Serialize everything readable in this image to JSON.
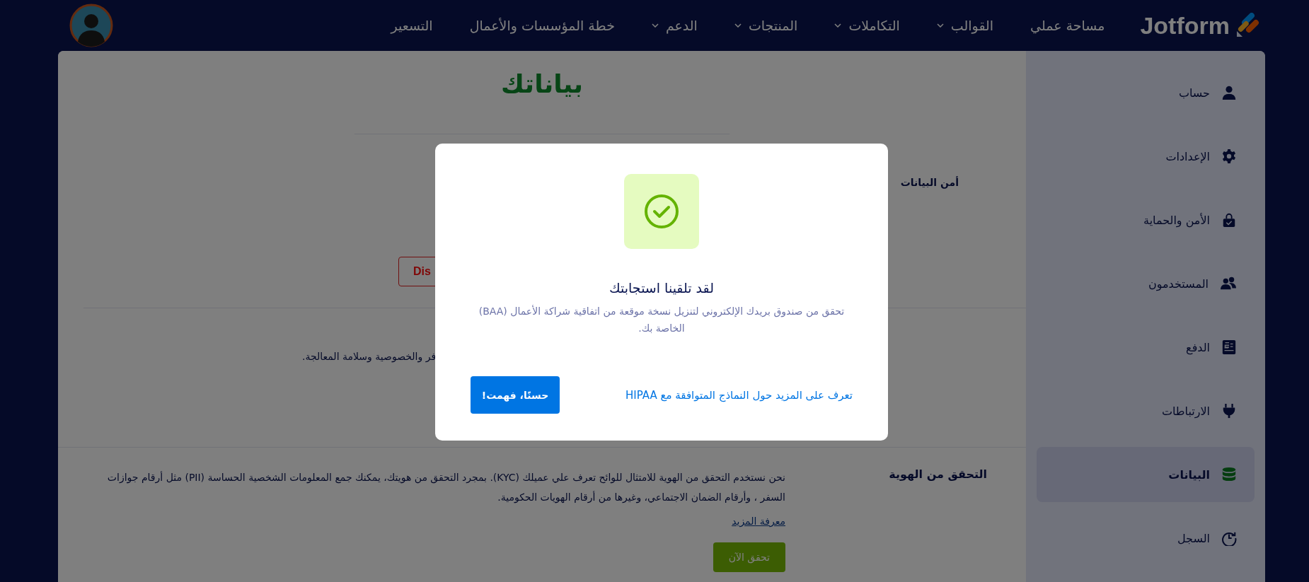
{
  "nav": {
    "logo": "Jotform",
    "items": [
      {
        "label": "مساحة عملي",
        "dropdown": false
      },
      {
        "label": "القوالب",
        "dropdown": true
      },
      {
        "label": "التكاملات",
        "dropdown": true
      },
      {
        "label": "المنتجات",
        "dropdown": true
      },
      {
        "label": "الدعم",
        "dropdown": true
      },
      {
        "label": "خطة المؤسسات والأعمال",
        "dropdown": false
      },
      {
        "label": "التسعير",
        "dropdown": false
      }
    ]
  },
  "sidebar": {
    "items": [
      {
        "label": "حساب",
        "selected": false
      },
      {
        "label": "الإعدادات",
        "selected": false
      },
      {
        "label": "الأمن والحماية",
        "selected": false
      },
      {
        "label": "المستخدمون",
        "selected": false
      },
      {
        "label": "الدفع",
        "selected": false
      },
      {
        "label": "الارتباطات",
        "selected": false
      },
      {
        "label": "البيانات",
        "selected": true
      },
      {
        "label": "السجل",
        "selected": false
      }
    ]
  },
  "main": {
    "title": "بياناتك",
    "data_security": {
      "heading": "أمن البيانات",
      "button": "Dis",
      "text": "فر والخصوصية وسلامة المعالجة."
    },
    "identity": {
      "heading": "التحقق من الهوية",
      "paragraph": "نحن نستخدم التحقق من الهوية للامتثال للوائح تعرف علي عميلك (KYC). بمجرد التحقق من هويتك، يمكنك جمع المعلومات الشخصية الحساسة (PII) مثل أرقام جوازات السفر ، وأرقام الضمان الاجتماعي، وغيرها من أرقام الهويات الحكومية.",
      "link": "معرفة المزيد",
      "button": "تحقق الآن"
    }
  },
  "modal": {
    "title": "لقد تلقينا استجابتك",
    "body": "تحقق من صندوق بريدك الإلكتروني لتنزيل نسخة موقعة من اتفاقية شراكة الأعمال (BAA) الخاصة بك.",
    "primary_button": "حسنًا، فهمت!",
    "link": "تعرف على المزيد حول النماذج المتوافقة مع HIPAA"
  }
}
